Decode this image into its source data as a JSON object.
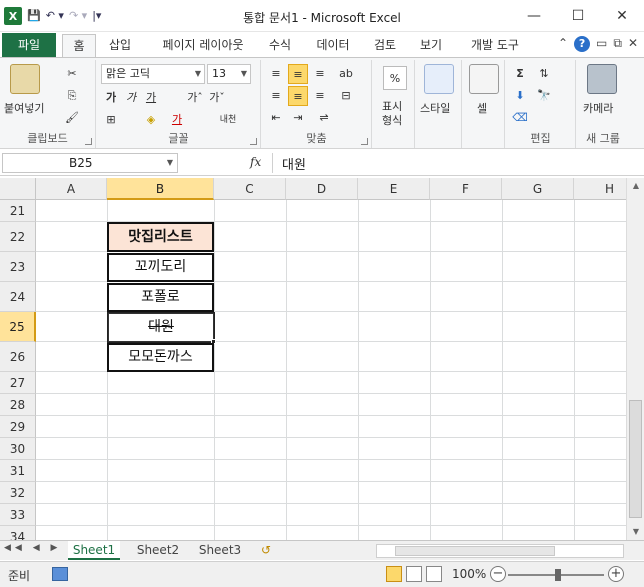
{
  "titlebar": {
    "title": "통합 문서1 - Microsoft Excel",
    "app_logo": "X",
    "qat_save": "💾",
    "qat_undo": "↶ ▾",
    "qat_redo": "↷ ▾",
    "qat_customize": "|▾",
    "minimize": "—",
    "maximize": "☐",
    "close": "✕"
  },
  "tabs": {
    "file": "파일",
    "items": [
      "홈",
      "삽입",
      "페이지 레이아웃",
      "수식",
      "데이터",
      "검토",
      "보기",
      "개발 도구"
    ],
    "active": "홈",
    "right_caret": "⌃",
    "help": "?",
    "win_min": "▭",
    "win_restore": "⧉",
    "win_close": "✕"
  },
  "ribbon": {
    "clipboard": {
      "label": "클립보드",
      "paste": "붙여넣기",
      "cut": "✂",
      "copy": "⎘",
      "format_painter": "🖌"
    },
    "font": {
      "label": "글꼴",
      "font_name": "맑은 고딕",
      "font_size": "13",
      "bold": "가",
      "italic": "가",
      "underline": "가",
      "grow": "가ˆ",
      "shrink": "가ˇ",
      "border": "⊞",
      "fill": "◈",
      "font_color": "가",
      "phonetic": "내천"
    },
    "alignment": {
      "label": "맞춤",
      "top": "≡",
      "middle": "≡",
      "bottom": "≡",
      "left": "≡",
      "center": "≡",
      "right": "≡",
      "wrap": "⇌",
      "merge": "⊟",
      "indent_dec": "⇤",
      "indent_inc": "⇥",
      "orientation": "ab"
    },
    "number": {
      "label": "표시 형식",
      "percent": "%",
      "line1": "표시",
      "line2": "형식"
    },
    "styles": {
      "label": "스타일",
      "button": "스타일"
    },
    "cells": {
      "label": "셀",
      "button": "셀"
    },
    "editing": {
      "label": "편집",
      "sum": "Σ",
      "sort": "⇅",
      "find": "🔭",
      "fill": "⬇",
      "clear": "⌫"
    },
    "camera": {
      "label": "새 그룹",
      "button": "카메라"
    }
  },
  "formula_bar": {
    "name_box": "B25",
    "fx": "fx",
    "content": "대원"
  },
  "grid": {
    "columns": [
      "A",
      "B",
      "C",
      "D",
      "E",
      "F",
      "G",
      "H"
    ],
    "selected_column": "B",
    "rows": [
      "21",
      "22",
      "23",
      "24",
      "25",
      "26",
      "27",
      "28",
      "29",
      "30",
      "31",
      "32",
      "33",
      "34"
    ],
    "selected_row": "25",
    "cells": {
      "B22": "맛집리스트",
      "B23": "꼬끼도리",
      "B24": "포폴로",
      "B25": "대원",
      "B26": "모모돈까스"
    },
    "header_fill": "#fce4d6",
    "selection_highlight": "#ffe39a"
  },
  "sheets": {
    "tabs": [
      "Sheet1",
      "Sheet2",
      "Sheet3"
    ],
    "active": "Sheet1",
    "nav": "◀◀ ◀ ▶ ▶▶",
    "new_sheet": "↺"
  },
  "statusbar": {
    "status": "준비",
    "zoom": "100%",
    "zoom_out": "−",
    "zoom_in": "+"
  }
}
